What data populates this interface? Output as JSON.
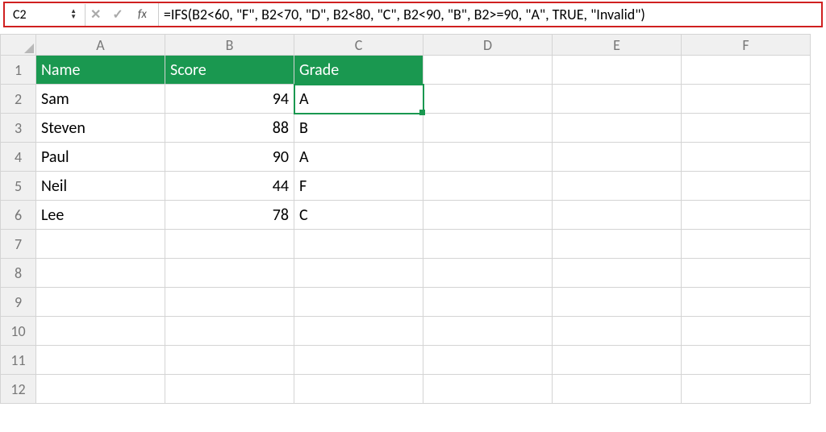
{
  "formula_bar": {
    "cell_ref": "C2",
    "cancel_icon": "✕",
    "confirm_icon": "✓",
    "fx_label": "fx",
    "formula": "=IFS(B2<60, \"F\", B2<70, \"D\", B2<80, \"C\", B2<90, \"B\", B2>=90, \"A\", TRUE, \"Invalid\")"
  },
  "columns": [
    "A",
    "B",
    "C",
    "D",
    "E",
    "F"
  ],
  "row_numbers": [
    "1",
    "2",
    "3",
    "4",
    "5",
    "6",
    "7",
    "8",
    "9",
    "10",
    "11",
    "12"
  ],
  "headers": {
    "A": "Name",
    "B": "Score",
    "C": "Grade"
  },
  "rows": [
    {
      "name": "Sam",
      "score": "94",
      "grade": "A"
    },
    {
      "name": "Steven",
      "score": "88",
      "grade": "B"
    },
    {
      "name": "Paul",
      "score": "90",
      "grade": "A"
    },
    {
      "name": "Neil",
      "score": "44",
      "grade": "F"
    },
    {
      "name": "Lee",
      "score": "78",
      "grade": "C"
    }
  ],
  "selected_cell": "C2"
}
